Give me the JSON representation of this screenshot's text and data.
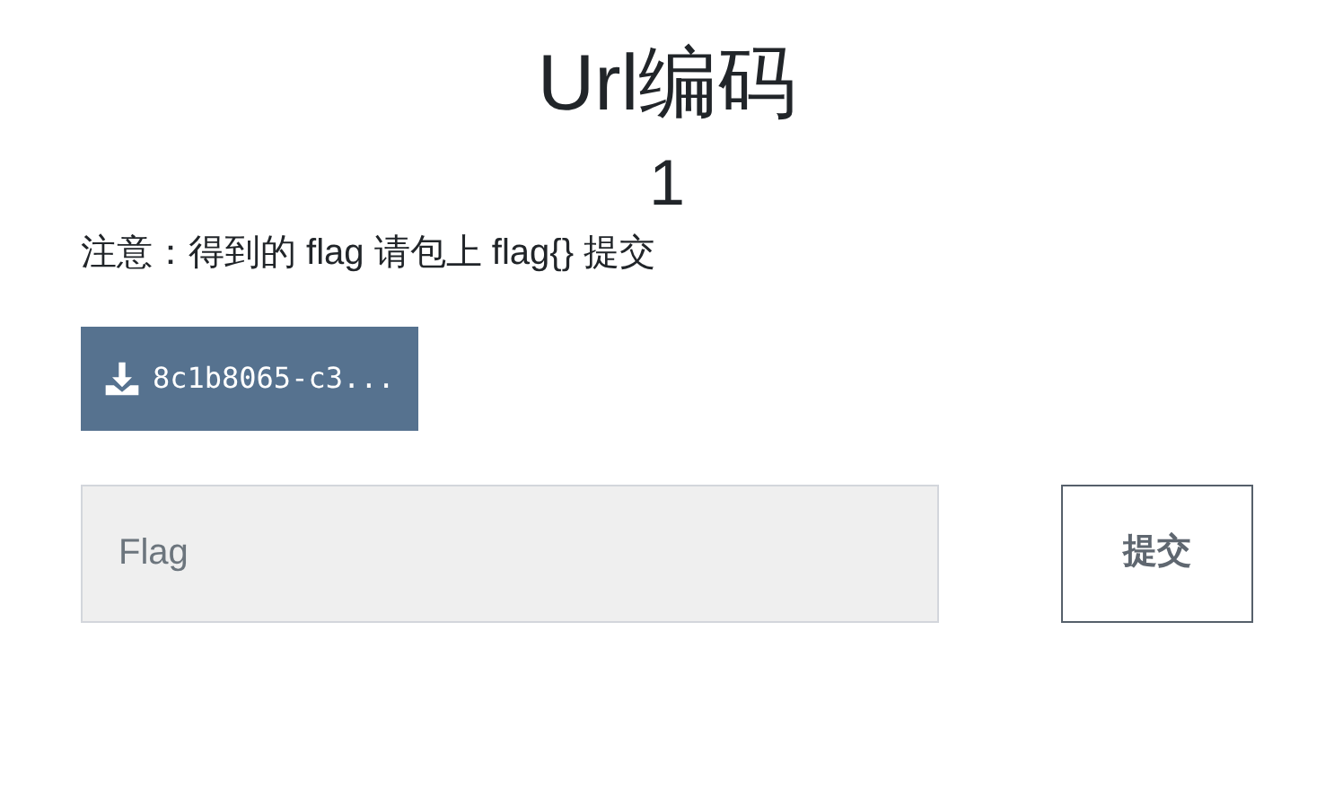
{
  "title": "Url编码",
  "points": "1",
  "notice": "注意：得到的 flag 请包上 flag{} 提交",
  "download": {
    "label": "8c1b8065-c3..."
  },
  "flag_field": {
    "placeholder": "Flag"
  },
  "submit_button": "提交"
}
